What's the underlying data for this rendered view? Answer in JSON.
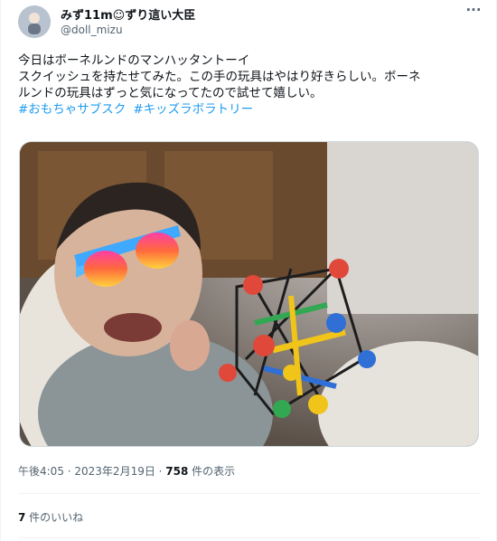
{
  "user": {
    "display_name": "みず11m☺ずり這い大臣",
    "handle": "@doll_mizu"
  },
  "tweet": {
    "lines": [
      "今日はボーネルンドのマンハッタントーイ",
      "スクイッシュを持たせてみた。この手の玩具はやはり好きらしい。ボーネ",
      "ルンドの玩具はずっと気になってたので試せて嬉しい。"
    ],
    "hashtags": [
      "#おもちゃサブスク",
      "#キッズラボラトリー"
    ]
  },
  "meta": {
    "timestamp": "午後4:05 · 2023年2月19日 · ",
    "views_count": "758",
    "views_label": " 件の表示"
  },
  "likes": {
    "count": "7",
    "label": " 件のいいね"
  },
  "icons": {
    "more": "more-options-icon"
  },
  "colors": {
    "hashtag": "#1d9bf0",
    "secondary_text": "#536471"
  }
}
